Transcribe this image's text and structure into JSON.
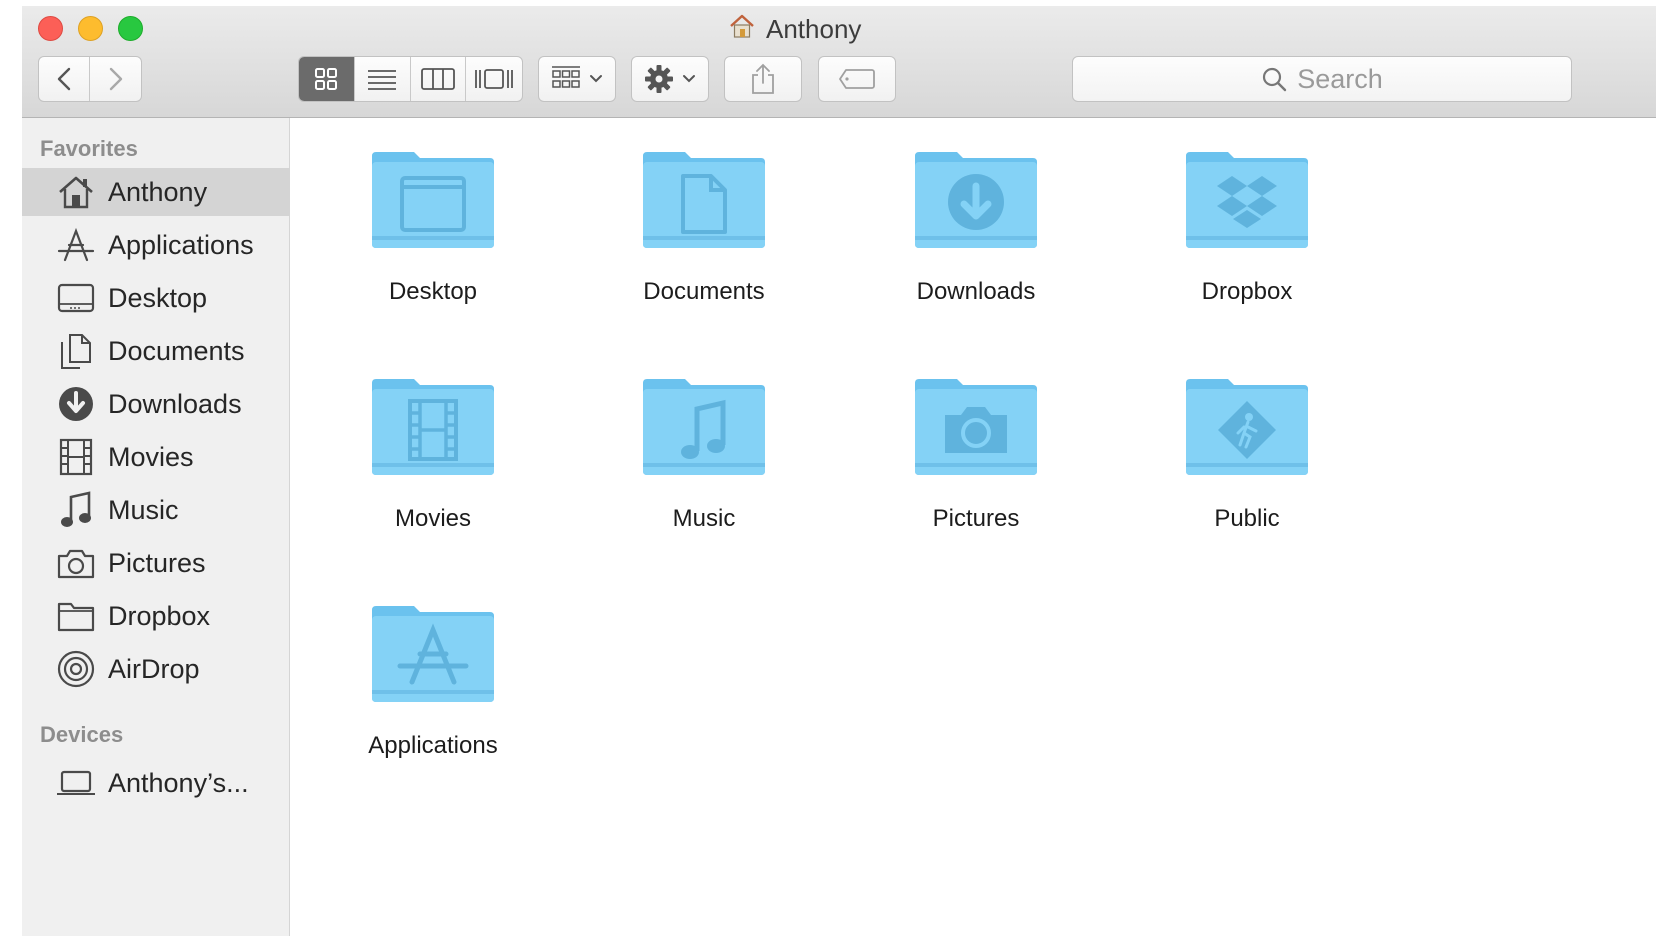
{
  "window": {
    "title": "Anthony"
  },
  "toolbar": {
    "back": "back",
    "forward": "forward",
    "view_modes": [
      "icon",
      "list",
      "column",
      "cover-flow"
    ],
    "active_view": "icon",
    "search_placeholder": "Search"
  },
  "sidebar": {
    "favorites_title": "Favorites",
    "favorites": [
      {
        "label": "Anthony",
        "icon": "home-icon",
        "selected": true
      },
      {
        "label": "Applications",
        "icon": "applications-icon"
      },
      {
        "label": "Desktop",
        "icon": "desktop-icon"
      },
      {
        "label": "Documents",
        "icon": "documents-icon"
      },
      {
        "label": "Downloads",
        "icon": "downloads-icon"
      },
      {
        "label": "Movies",
        "icon": "movies-icon"
      },
      {
        "label": "Music",
        "icon": "music-icon"
      },
      {
        "label": "Pictures",
        "icon": "pictures-icon"
      },
      {
        "label": "Dropbox",
        "icon": "folder-icon"
      },
      {
        "label": "AirDrop",
        "icon": "airdrop-icon"
      }
    ],
    "devices_title": "Devices",
    "devices": [
      {
        "label": "Anthony’s...",
        "icon": "laptop-icon"
      }
    ]
  },
  "content": {
    "folders": [
      {
        "label": "Desktop",
        "icon": "desktop-folder-icon"
      },
      {
        "label": "Documents",
        "icon": "documents-folder-icon"
      },
      {
        "label": "Downloads",
        "icon": "downloads-folder-icon"
      },
      {
        "label": "Dropbox",
        "icon": "dropbox-folder-icon"
      },
      {
        "label": "Movies",
        "icon": "movies-folder-icon"
      },
      {
        "label": "Music",
        "icon": "music-folder-icon"
      },
      {
        "label": "Pictures",
        "icon": "pictures-folder-icon"
      },
      {
        "label": "Public",
        "icon": "public-folder-icon"
      },
      {
        "label": "Applications",
        "icon": "applications-folder-icon"
      }
    ]
  },
  "colors": {
    "folder": "#7ccdf3",
    "folder_dark": "#5fb8e6",
    "folder_glyph": "#5fb3dd",
    "sidebar_bg": "#f0f0f0",
    "selection": "#d4d4d4"
  }
}
